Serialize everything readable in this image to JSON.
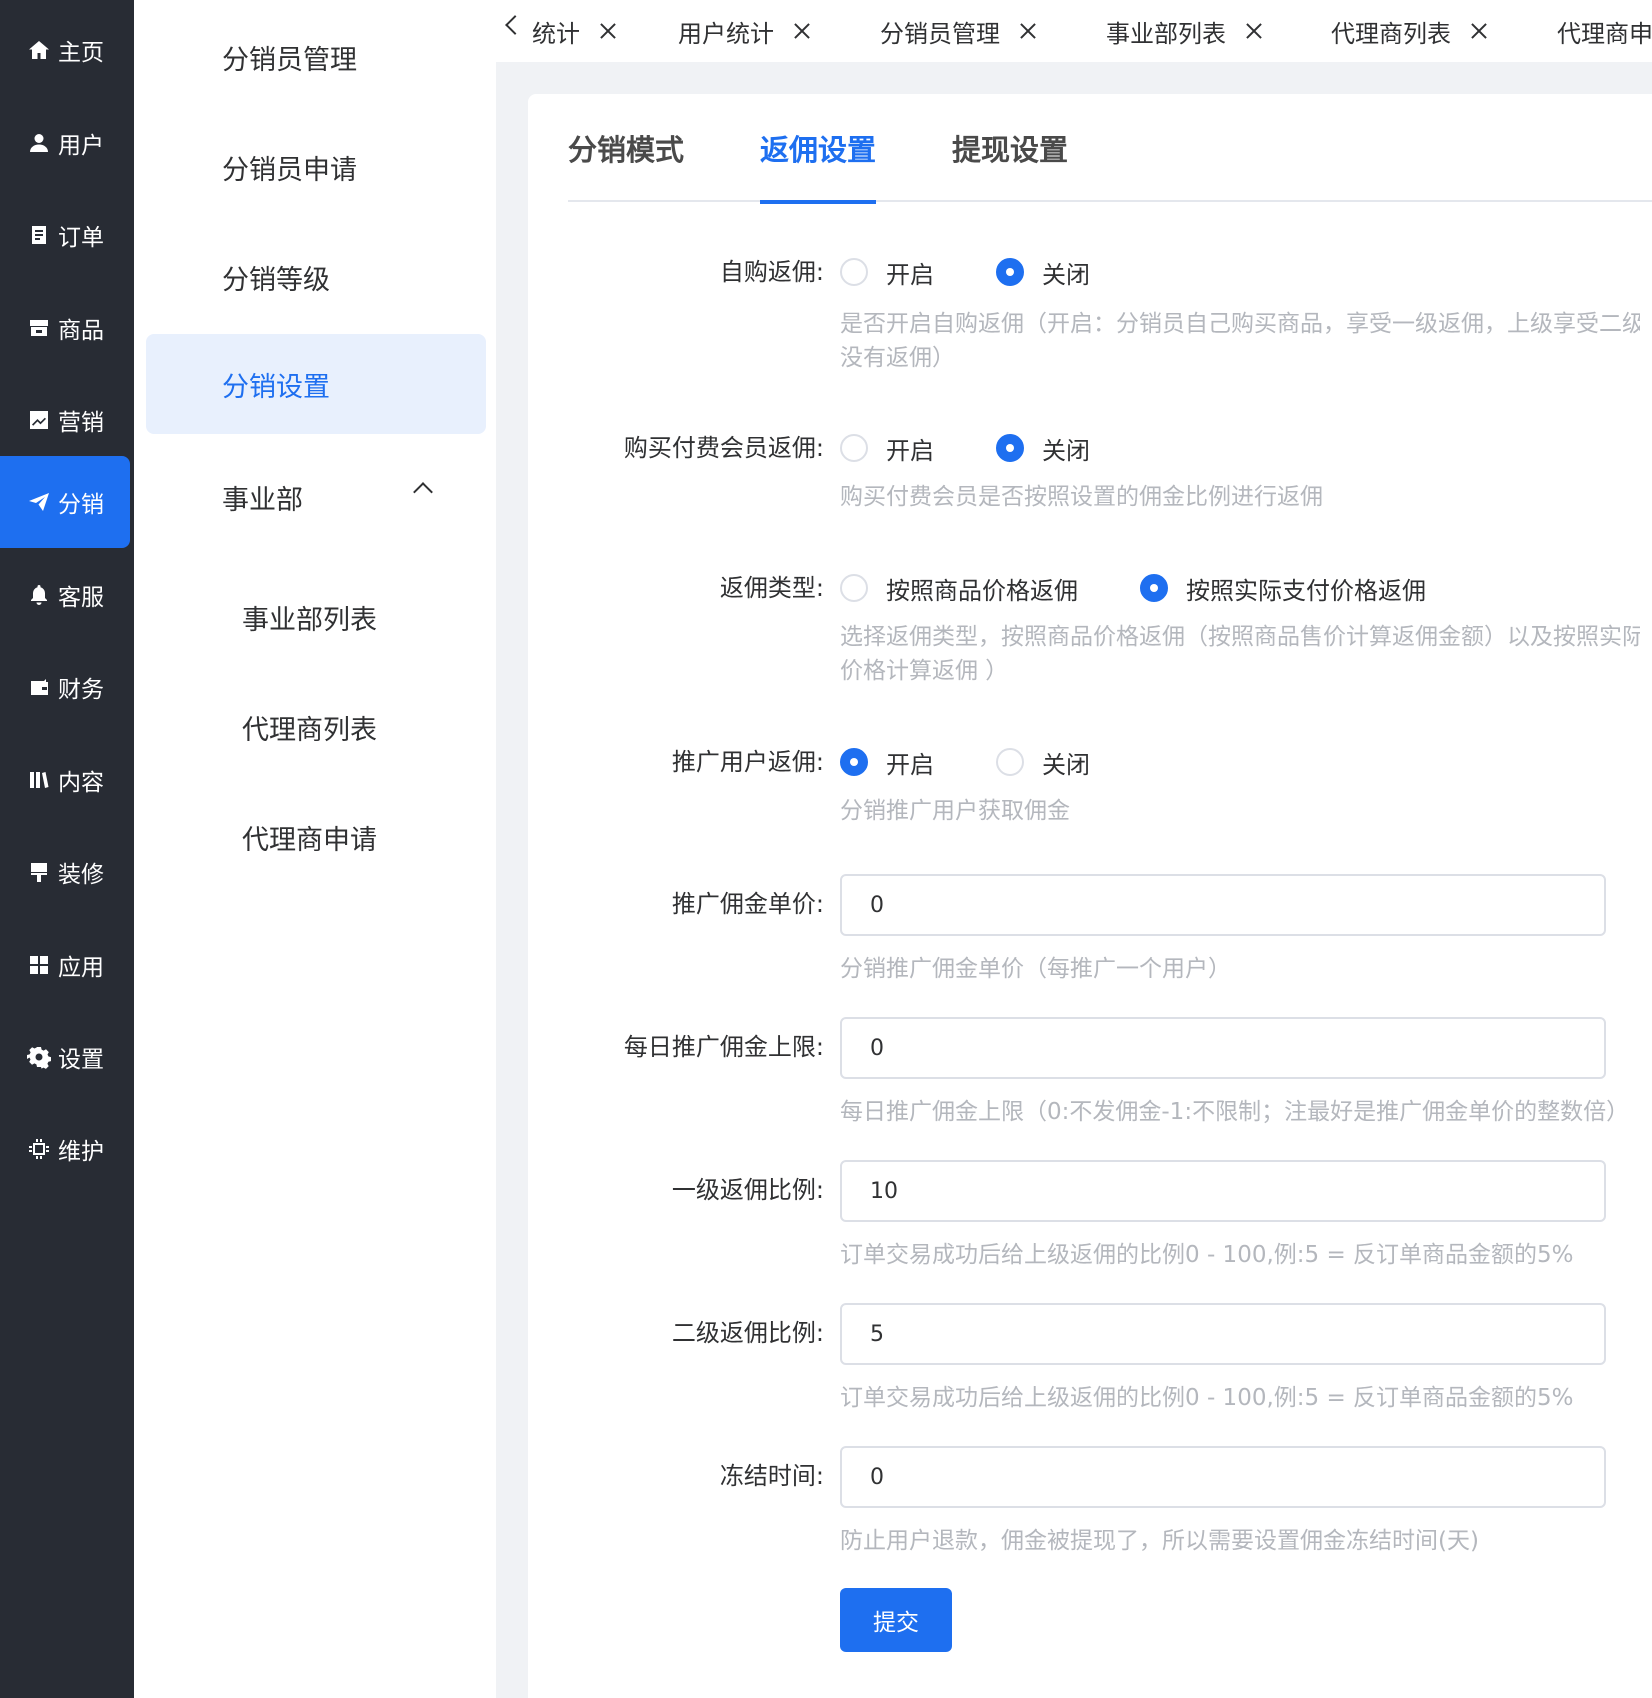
{
  "sidebar": {
    "items": [
      {
        "label": "主页",
        "icon": "home-icon"
      },
      {
        "label": "用户",
        "icon": "user-icon"
      },
      {
        "label": "订单",
        "icon": "order-icon"
      },
      {
        "label": "商品",
        "icon": "product-icon"
      },
      {
        "label": "营销",
        "icon": "chart-icon"
      },
      {
        "label": "分销",
        "icon": "send-icon",
        "active": true
      },
      {
        "label": "客服",
        "icon": "bell-icon"
      },
      {
        "label": "财务",
        "icon": "wallet-icon"
      },
      {
        "label": "内容",
        "icon": "book-icon"
      },
      {
        "label": "装修",
        "icon": "brush-icon"
      },
      {
        "label": "应用",
        "icon": "grid-icon"
      },
      {
        "label": "设置",
        "icon": "gear-icon"
      },
      {
        "label": "维护",
        "icon": "chip-icon"
      }
    ]
  },
  "submenu": {
    "items": [
      {
        "label": "分销员管理"
      },
      {
        "label": "分销员申请"
      },
      {
        "label": "分销等级"
      },
      {
        "label": "分销设置",
        "active": true
      },
      {
        "label": "事业部",
        "expanded": true
      },
      {
        "label": "事业部列表"
      },
      {
        "label": "代理商列表"
      },
      {
        "label": "代理商申请"
      }
    ]
  },
  "tabs": {
    "items": [
      {
        "label": "统计"
      },
      {
        "label": "用户统计"
      },
      {
        "label": "分销员管理"
      },
      {
        "label": "事业部列表"
      },
      {
        "label": "代理商列表"
      },
      {
        "label": "代理商申请"
      }
    ]
  },
  "settings_tabs": {
    "items": [
      {
        "label": "分销模式"
      },
      {
        "label": "返佣设置",
        "active": true
      },
      {
        "label": "提现设置"
      }
    ]
  },
  "form": {
    "self_purchase": {
      "label": "自购返佣:",
      "options": [
        "开启",
        "关闭"
      ],
      "selected": "关闭",
      "hint_line1": "是否开启自购返佣（开启：分销员自己购买商品，享受一级返佣，上级享受二级返佣；关闭：分销员自己购买商品",
      "hint_line2": "没有返佣）"
    },
    "paid_member": {
      "label": "购买付费会员返佣:",
      "options": [
        "开启",
        "关闭"
      ],
      "selected": "关闭",
      "hint": "购买付费会员是否按照设置的佣金比例进行返佣"
    },
    "commission_type": {
      "label": "返佣类型:",
      "options": [
        "按照商品价格返佣",
        "按照实际支付价格返佣"
      ],
      "selected": "按照实际支付价格返佣",
      "hint_line1": "选择返佣类型，按照商品价格返佣（按照商品售价计算返佣金额）以及按照实际支付价格返佣（按照实际支付",
      "hint_line2": "价格计算返佣 ）"
    },
    "promo_user": {
      "label": "推广用户返佣:",
      "options": [
        "开启",
        "关闭"
      ],
      "selected": "开启",
      "hint": "分销推广用户获取佣金"
    },
    "promo_unit_price": {
      "label": "推广佣金单价:",
      "value": "0",
      "hint": "分销推广佣金单价（每推广一个用户）"
    },
    "daily_limit": {
      "label": "每日推广佣金上限:",
      "value": "0",
      "hint": "每日推广佣金上限（0:不发佣金-1:不限制；注最好是推广佣金单价的整数倍）"
    },
    "level1_ratio": {
      "label": "一级返佣比例:",
      "value": "10",
      "hint": "订单交易成功后给上级返佣的比例0 - 100,例:5 = 反订单商品金额的5%"
    },
    "level2_ratio": {
      "label": "二级返佣比例:",
      "value": "5",
      "hint": "订单交易成功后给上级返佣的比例0 - 100,例:5 = 反订单商品金额的5%"
    },
    "freeze_time": {
      "label": "冻结时间:",
      "value": "0",
      "hint": "防止用户退款，佣金被提现了，所以需要设置佣金冻结时间(天)"
    },
    "submit_label": "提交"
  },
  "colors": {
    "accent": "#1e6ff0",
    "sidebar_bg": "#282c34",
    "hint_text": "#b4b7bd"
  }
}
